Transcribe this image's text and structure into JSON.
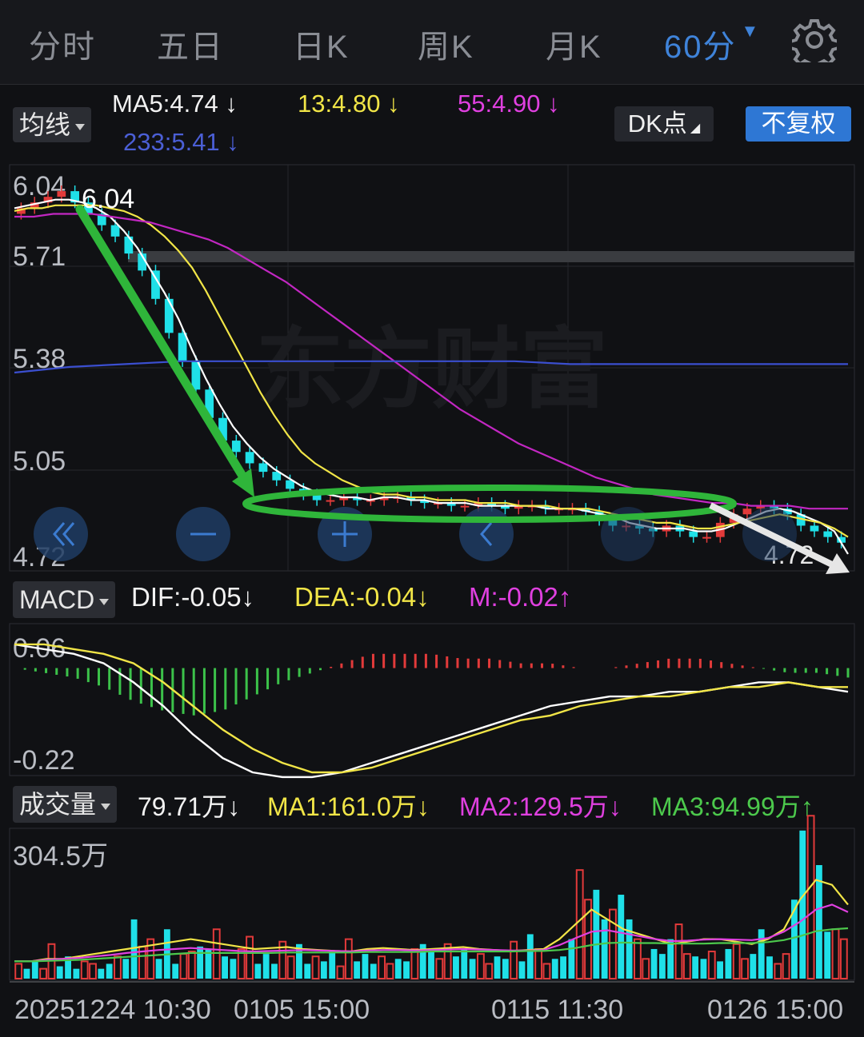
{
  "tabs": [
    {
      "label": "分时",
      "active": false
    },
    {
      "label": "五日",
      "active": false
    },
    {
      "label": "日K",
      "active": false
    },
    {
      "label": "周K",
      "active": false
    },
    {
      "label": "月K",
      "active": false
    },
    {
      "label": "60分",
      "active": true
    }
  ],
  "settings_icon": "gear-icon",
  "ma_panel": {
    "selector": "均线",
    "ma5": "MA5:4.74",
    "ma13": "13:4.80",
    "ma55": "55:4.90",
    "ma233": "233:5.41",
    "arrow": "↓",
    "dk_button": "DK点",
    "fq_button": "不复权"
  },
  "macd_panel": {
    "selector": "MACD",
    "dif": "DIF:-0.05",
    "dea": "DEA:-0.04",
    "m": "M:-0.02",
    "down": "↓",
    "up": "↑"
  },
  "vol_panel": {
    "selector": "成交量",
    "vol": "79.71万",
    "ma1": "MA1:161.0万",
    "ma2": "MA2:129.5万",
    "ma3": "MA3:94.99万",
    "down": "↓",
    "up": "↑"
  },
  "watermark": "东方财富",
  "nav_icons": [
    "double-left-icon",
    "zoom-out-icon",
    "zoom-in-icon",
    "left-icon"
  ],
  "colors": {
    "bg": "#101114",
    "up": "#e23a3a",
    "down": "#1fe0e8",
    "ma5": "#ffffff",
    "ma13": "#f1e547",
    "ma55": "#c227c2",
    "ma233": "#3b4fd0",
    "annot": "#2fb53a"
  },
  "chart_data": [
    {
      "type": "candlestick",
      "title": "",
      "y_ticks": [
        "6.04",
        "5.71",
        "5.38",
        "5.05",
        "4.72"
      ],
      "ylim": [
        4.72,
        6.04
      ],
      "price_high_label": "6.04",
      "price_low_label": "4.72",
      "x_labels": [
        "20251224 10:30",
        "0105 15:00",
        "0115 11:30",
        "0126 15:00"
      ],
      "close": [
        5.96,
        5.98,
        6.0,
        6.02,
        5.98,
        5.94,
        5.9,
        5.86,
        5.8,
        5.74,
        5.64,
        5.52,
        5.42,
        5.32,
        5.22,
        5.14,
        5.1,
        5.06,
        5.03,
        5.0,
        4.97,
        4.95,
        4.93,
        4.93,
        4.94,
        4.93,
        4.93,
        4.94,
        4.94,
        4.93,
        4.92,
        4.92,
        4.91,
        4.91,
        4.92,
        4.91,
        4.9,
        4.91,
        4.91,
        4.9,
        4.9,
        4.9,
        4.89,
        4.86,
        4.84,
        4.84,
        4.83,
        4.82,
        4.84,
        4.82,
        4.8,
        4.8,
        4.85,
        4.88,
        4.9,
        4.91,
        4.9,
        4.88,
        4.84,
        4.82,
        4.8,
        4.78
      ],
      "series": [
        {
          "name": "MA5",
          "values": [
            5.96,
            5.97,
            5.98,
            5.99,
            5.99,
            5.98,
            5.96,
            5.93,
            5.88,
            5.82,
            5.74,
            5.66,
            5.57,
            5.46,
            5.36,
            5.27,
            5.19,
            5.13,
            5.08,
            5.04,
            5.01,
            4.98,
            4.96,
            4.95,
            4.94,
            4.94,
            4.93,
            4.94,
            4.94,
            4.93,
            4.93,
            4.92,
            4.92,
            4.92,
            4.91,
            4.91,
            4.91,
            4.91,
            4.91,
            4.9,
            4.9,
            4.9,
            4.89,
            4.88,
            4.87,
            4.85,
            4.84,
            4.83,
            4.83,
            4.83,
            4.82,
            4.82,
            4.83,
            4.85,
            4.87,
            4.89,
            4.9,
            4.89,
            4.87,
            4.85,
            4.82,
            4.74
          ]
        },
        {
          "name": "MA13",
          "values": [
            5.95,
            5.96,
            5.96,
            5.97,
            5.97,
            5.97,
            5.97,
            5.96,
            5.95,
            5.93,
            5.9,
            5.86,
            5.81,
            5.75,
            5.67,
            5.58,
            5.49,
            5.4,
            5.31,
            5.23,
            5.16,
            5.1,
            5.06,
            5.03,
            5.0,
            4.98,
            4.96,
            4.95,
            4.95,
            4.94,
            4.94,
            4.93,
            4.93,
            4.93,
            4.92,
            4.92,
            4.92,
            4.91,
            4.91,
            4.91,
            4.9,
            4.9,
            4.9,
            4.89,
            4.88,
            4.87,
            4.86,
            4.85,
            4.85,
            4.84,
            4.83,
            4.83,
            4.84,
            4.85,
            4.86,
            4.87,
            4.88,
            4.87,
            4.86,
            4.85,
            4.83,
            4.8
          ]
        },
        {
          "name": "MA55",
          "values": [
            5.93,
            5.93,
            5.94,
            5.94,
            5.94,
            5.93,
            5.92,
            5.91,
            5.89,
            5.87,
            5.85,
            5.82,
            5.78,
            5.74,
            5.7,
            5.65,
            5.6,
            5.55,
            5.5,
            5.45,
            5.4,
            5.35,
            5.3,
            5.25,
            5.21,
            5.17,
            5.13,
            5.1,
            5.07,
            5.04,
            5.01,
            4.99,
            4.97,
            4.95,
            4.94,
            4.93,
            4.92,
            4.92,
            4.91,
            4.91,
            4.91,
            4.9,
            4.9,
            4.9
          ]
        },
        {
          "name": "MA233",
          "values": [
            5.38,
            5.4,
            5.41,
            5.42,
            5.42,
            5.42,
            5.42,
            5.42,
            5.42,
            5.42,
            5.41,
            5.41,
            5.41,
            5.41,
            5.41,
            5.41
          ]
        }
      ]
    },
    {
      "type": "bar",
      "title": "MACD",
      "y_ticks": [
        "0.06",
        "-0.22"
      ],
      "ylim": [
        -0.22,
        0.06
      ],
      "series": [
        {
          "name": "DIF",
          "values": [
            0.05,
            0.04,
            0.03,
            0.01,
            -0.03,
            -0.08,
            -0.14,
            -0.19,
            -0.22,
            -0.23,
            -0.23,
            -0.22,
            -0.2,
            -0.18,
            -0.16,
            -0.14,
            -0.12,
            -0.1,
            -0.08,
            -0.07,
            -0.06,
            -0.06,
            -0.05,
            -0.05,
            -0.04,
            -0.03,
            -0.03,
            -0.04,
            -0.05
          ]
        },
        {
          "name": "DEA",
          "values": [
            0.05,
            0.05,
            0.04,
            0.03,
            0.01,
            -0.03,
            -0.08,
            -0.13,
            -0.17,
            -0.2,
            -0.22,
            -0.22,
            -0.21,
            -0.19,
            -0.17,
            -0.15,
            -0.13,
            -0.11,
            -0.1,
            -0.08,
            -0.07,
            -0.06,
            -0.06,
            -0.05,
            -0.04,
            -0.04,
            -0.03,
            -0.04,
            -0.04
          ]
        },
        {
          "name": "M",
          "values": [
            0.0,
            -0.01,
            -0.02,
            -0.04,
            -0.07,
            -0.09,
            -0.1,
            -0.09,
            -0.06,
            -0.03,
            -0.01,
            0.01,
            0.03,
            0.03,
            0.03,
            0.02,
            0.02,
            0.01,
            0.01,
            0.0,
            0.0,
            0.01,
            0.02,
            0.02,
            0.01,
            0.0,
            -0.01,
            -0.01,
            -0.02
          ]
        }
      ]
    },
    {
      "type": "bar",
      "title": "成交量",
      "y_ticks": [
        "304.5万"
      ],
      "ylim": [
        0,
        304.5
      ],
      "values": [
        30,
        20,
        35,
        20,
        70,
        25,
        45,
        20,
        35,
        30,
        20,
        30,
        45,
        40,
        120,
        65,
        80,
        40,
        100,
        30,
        50,
        55,
        65,
        60,
        100,
        45,
        40,
        60,
        85,
        30,
        50,
        30,
        75,
        45,
        70,
        30,
        45,
        35,
        55,
        25,
        80,
        35,
        50,
        30,
        45,
        30,
        40,
        35,
        60,
        70,
        55,
        40,
        70,
        45,
        60,
        40,
        50,
        30,
        45,
        40,
        75,
        35,
        90,
        60,
        30,
        40,
        45,
        80,
        220,
        160,
        180,
        120,
        140,
        170,
        120,
        80,
        40,
        60,
        50,
        80,
        110,
        50,
        45,
        40,
        55,
        35,
        60,
        70,
        40,
        50,
        100,
        45,
        30,
        50,
        160,
        300,
        330,
        230,
        95,
        100,
        80
      ],
      "series": [
        {
          "name": "MA1",
          "values": [
            35,
            35,
            40,
            40,
            45,
            50,
            55,
            60,
            65,
            70,
            75,
            80,
            75,
            70,
            65,
            60,
            62,
            64,
            60,
            58,
            56,
            55,
            60,
            62,
            60,
            58,
            60,
            62,
            64,
            60,
            58,
            56,
            58,
            60,
            80,
            110,
            140,
            120,
            100,
            90,
            80,
            70,
            75,
            80,
            80,
            75,
            70,
            80,
            100,
            160,
            200,
            190,
            150
          ]
        },
        {
          "name": "MA2",
          "values": [
            35,
            35,
            38,
            40,
            42,
            45,
            48,
            52,
            55,
            58,
            60,
            62,
            60,
            58,
            56,
            55,
            56,
            57,
            58,
            57,
            56,
            55,
            57,
            58,
            58,
            57,
            58,
            59,
            60,
            59,
            58,
            57,
            57,
            58,
            68,
            82,
            95,
            98,
            92,
            86,
            80,
            76,
            77,
            79,
            80,
            79,
            78,
            82,
            95,
            115,
            140,
            150,
            135
          ]
        },
        {
          "name": "MA3",
          "values": [
            35,
            35,
            36,
            37,
            38,
            40,
            42,
            44,
            46,
            48,
            50,
            52,
            52,
            52,
            52,
            52,
            52,
            53,
            53,
            53,
            53,
            53,
            54,
            54,
            54,
            54,
            55,
            55,
            55,
            55,
            55,
            55,
            56,
            56,
            58,
            62,
            68,
            72,
            73,
            72,
            72,
            71,
            71,
            71,
            72,
            72,
            72,
            74,
            78,
            86,
            96,
            100,
            102
          ]
        }
      ]
    }
  ]
}
